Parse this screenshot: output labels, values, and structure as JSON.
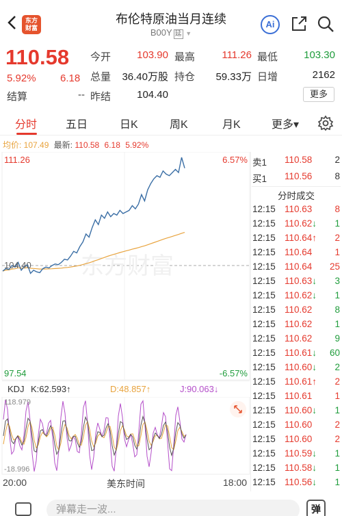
{
  "header": {
    "logo_line1": "东方",
    "logo_line2": "财富",
    "title": "布伦特原油当月连续",
    "code": "B00Y",
    "code_tag": "延",
    "ai_label": "Ai"
  },
  "quote": {
    "price": "110.58",
    "pct": "5.92%",
    "change": "6.18",
    "open_label": "今开",
    "open": "103.90",
    "high_label": "最高",
    "high": "111.26",
    "low_label": "最低",
    "low": "103.30",
    "volume_label": "总量",
    "volume": "36.40万股",
    "oi_label": "持仓",
    "oi": "59.33万",
    "daily_inc_label": "日增",
    "daily_inc": "2162",
    "settle_label": "结算",
    "settle": "--",
    "prev_settle_label": "昨结",
    "prev_settle": "104.40",
    "more_label": "更多"
  },
  "tabs": [
    "分时",
    "五日",
    "日K",
    "周K",
    "月K",
    "更多▾"
  ],
  "avgline": {
    "avg_label": "均价: ",
    "avg": "107.49",
    "latest_label": "最新: ",
    "latest": "110.58",
    "change": "6.18",
    "pct": "5.92%"
  },
  "chart_labels": {
    "top_price": "111.26",
    "top_pct": "6.57%",
    "mid_price": "104.40",
    "bottom_price": "97.54",
    "bottom_pct": "-6.57%",
    "watermark": "东方财富",
    "time_start": "20:00",
    "time_mid": "美东时间",
    "time_end": "18:00"
  },
  "kdj": {
    "name": "KDJ",
    "k": "K:62.593↑",
    "d": "D:48.857↑",
    "j": "J:90.063↓",
    "top": "118.979",
    "bottom": "-18.996"
  },
  "orderbook": {
    "sell_label": "卖1",
    "sell_price": "110.58",
    "sell_vol": "2",
    "buy_label": "买1",
    "buy_price": "110.56",
    "buy_vol": "8",
    "trades_title": "分时成交"
  },
  "trades": [
    {
      "time": "12:15",
      "price": "110.63",
      "vol": "8",
      "arrow": "",
      "dir": "up"
    },
    {
      "time": "12:15",
      "price": "110.62",
      "vol": "1",
      "arrow": "↓",
      "dir": "down"
    },
    {
      "time": "12:15",
      "price": "110.64",
      "vol": "2",
      "arrow": "↑",
      "dir": "up"
    },
    {
      "time": "12:15",
      "price": "110.64",
      "vol": "1",
      "arrow": "",
      "dir": "up"
    },
    {
      "time": "12:15",
      "price": "110.64",
      "vol": "25",
      "arrow": "",
      "dir": "up"
    },
    {
      "time": "12:15",
      "price": "110.63",
      "vol": "3",
      "arrow": "↓",
      "dir": "down"
    },
    {
      "time": "12:15",
      "price": "110.62",
      "vol": "1",
      "arrow": "↓",
      "dir": "down"
    },
    {
      "time": "12:15",
      "price": "110.62",
      "vol": "8",
      "arrow": "",
      "dir": "down"
    },
    {
      "time": "12:15",
      "price": "110.62",
      "vol": "1",
      "arrow": "",
      "dir": "down"
    },
    {
      "time": "12:15",
      "price": "110.62",
      "vol": "9",
      "arrow": "",
      "dir": "down"
    },
    {
      "time": "12:15",
      "price": "110.61",
      "vol": "60",
      "arrow": "↓",
      "dir": "down"
    },
    {
      "time": "12:15",
      "price": "110.60",
      "vol": "2",
      "arrow": "↓",
      "dir": "down"
    },
    {
      "time": "12:15",
      "price": "110.61",
      "vol": "2",
      "arrow": "↑",
      "dir": "up"
    },
    {
      "time": "12:15",
      "price": "110.61",
      "vol": "1",
      "arrow": "",
      "dir": "up"
    },
    {
      "time": "12:15",
      "price": "110.60",
      "vol": "1",
      "arrow": "↓",
      "dir": "down"
    },
    {
      "time": "12:15",
      "price": "110.60",
      "vol": "2",
      "arrow": "",
      "dir": "up"
    },
    {
      "time": "12:15",
      "price": "110.60",
      "vol": "2",
      "arrow": "",
      "dir": "up"
    },
    {
      "time": "12:15",
      "price": "110.59",
      "vol": "1",
      "arrow": "↓",
      "dir": "down"
    },
    {
      "time": "12:15",
      "price": "110.58",
      "vol": "1",
      "arrow": "↓",
      "dir": "down"
    },
    {
      "time": "12:15",
      "price": "110.56",
      "vol": "1",
      "arrow": "↓",
      "dir": "down"
    }
  ],
  "bottom_bar": {
    "placeholder": "弹幕走一波...",
    "toggle_label": "弹"
  },
  "colors": {
    "up": "#e5392d",
    "down": "#1f9c3b",
    "price_line": "#3a6ea5",
    "avg_line": "#e8a33d"
  }
}
